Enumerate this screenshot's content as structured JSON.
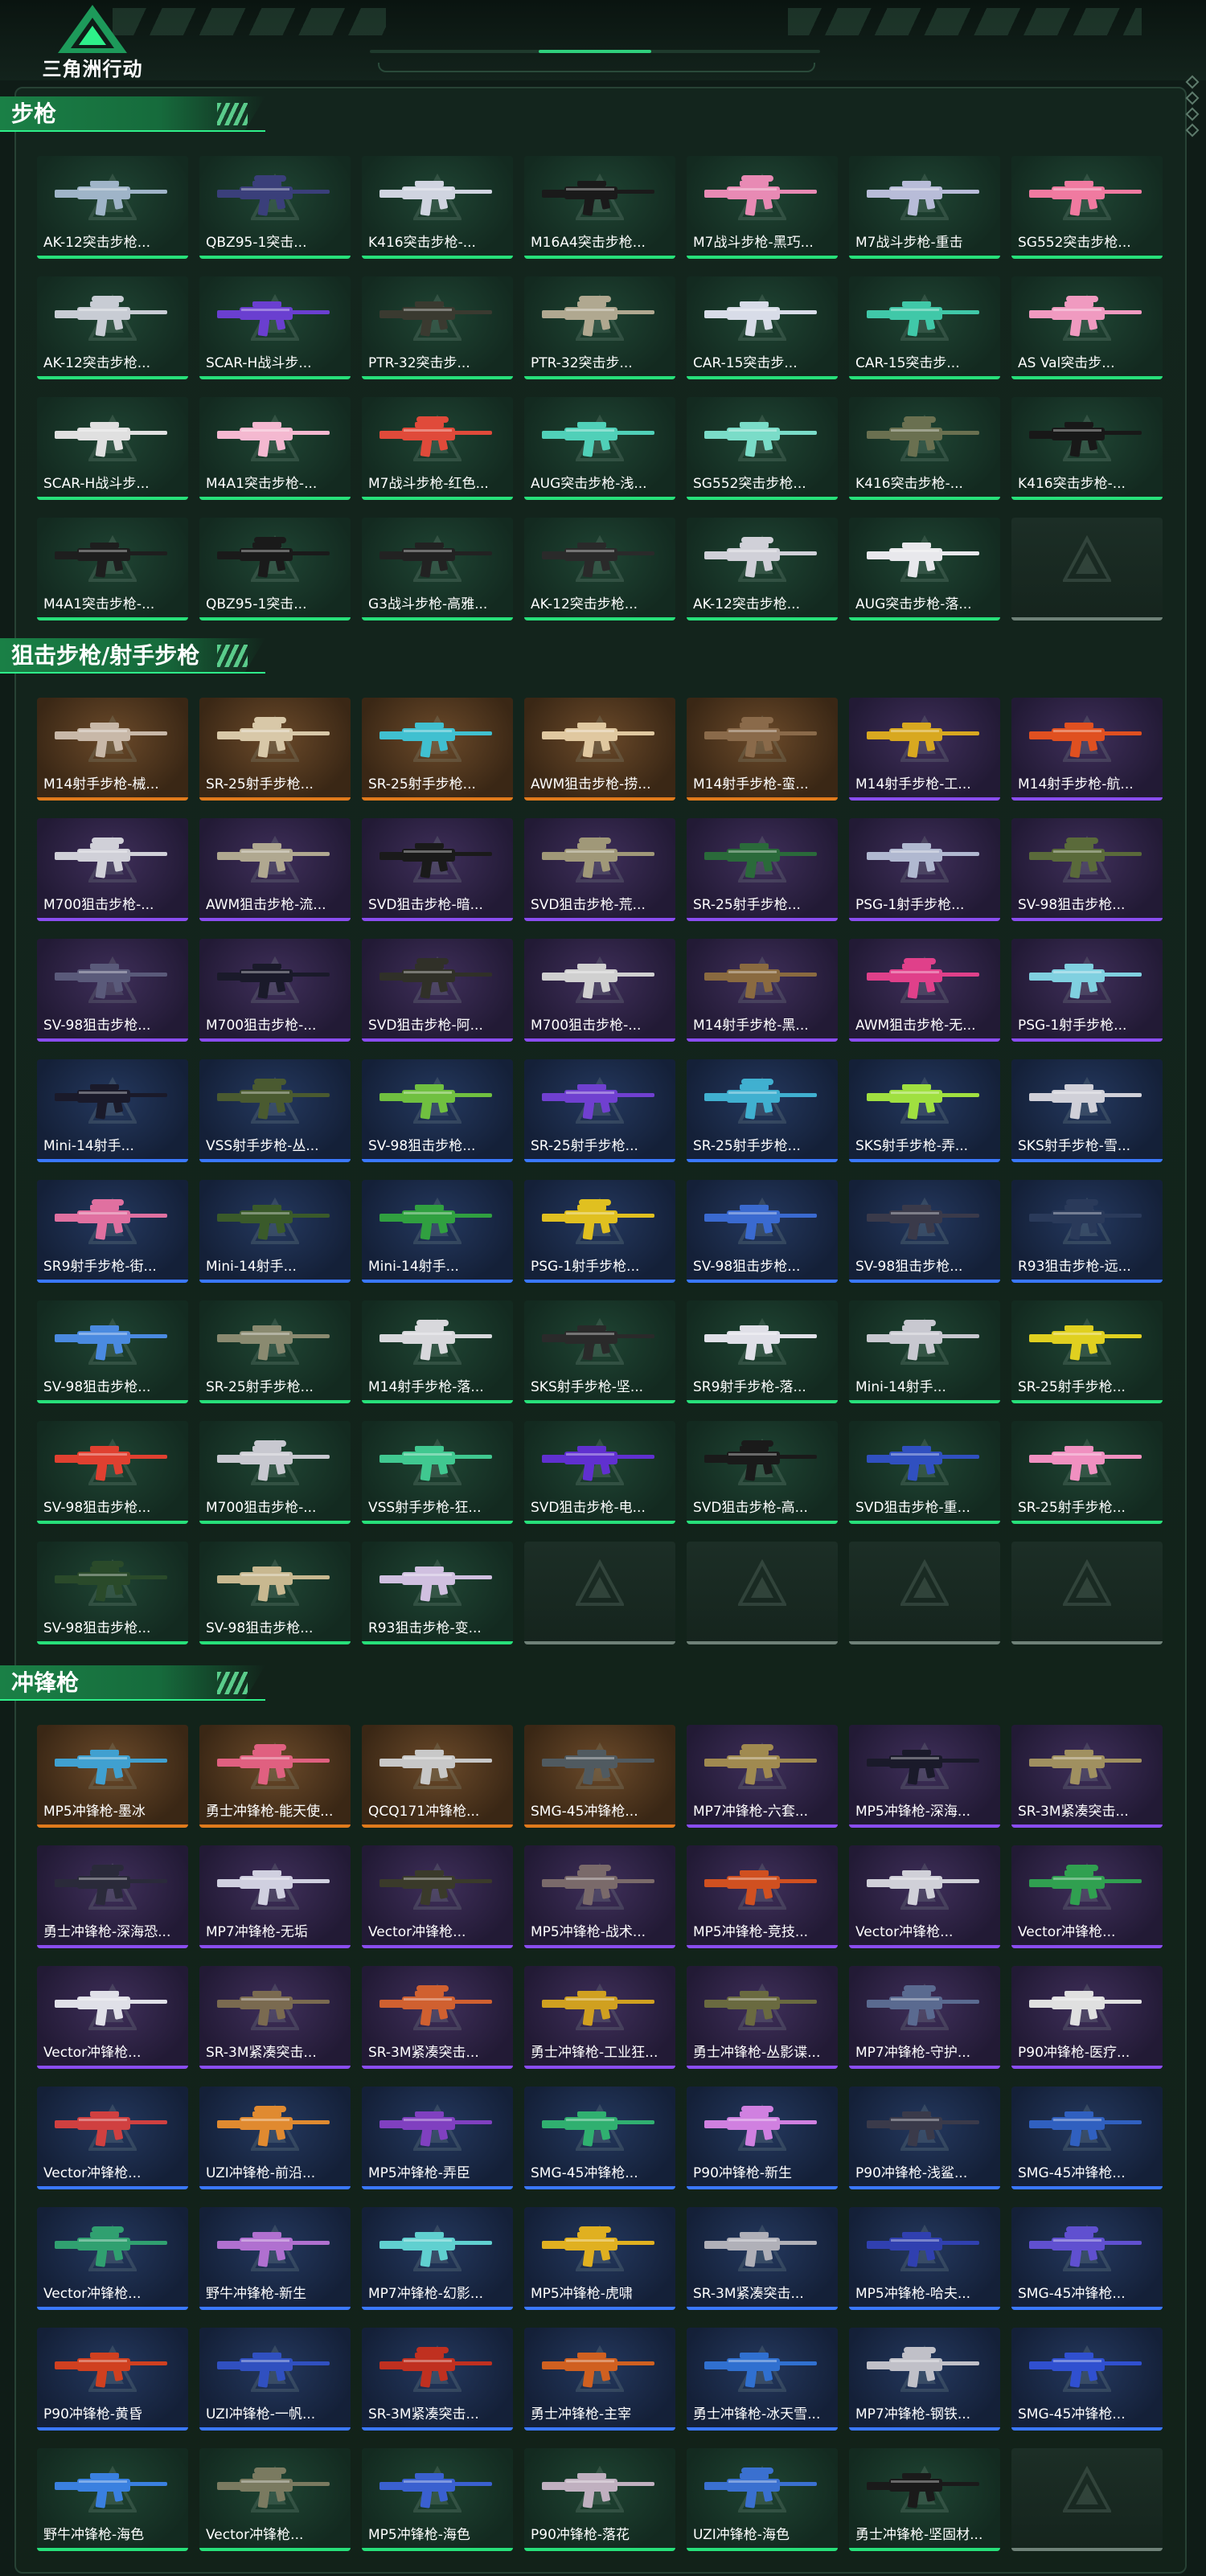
{
  "brand": {
    "logo_text": "三角洲行动",
    "logo_icon": "delta-triangle-icon",
    "accent": "#2ef08a"
  },
  "sections": [
    {
      "title": "步枪",
      "items": [
        {
          "name": "AK-12突击步枪...",
          "color": "#9fb4c8",
          "tier": "green"
        },
        {
          "name": "QBZ95-1突击...",
          "color": "#3a3f7a",
          "tier": "green"
        },
        {
          "name": "K416突击步枪-...",
          "color": "#d0d4e0",
          "tier": "green"
        },
        {
          "name": "M16A4突击步枪...",
          "color": "#1a1a1a",
          "tier": "green"
        },
        {
          "name": "M7战斗步枪-黑巧...",
          "color": "#e88ab4",
          "tier": "green"
        },
        {
          "name": "M7战斗步枪-重击",
          "color": "#b8bcd8",
          "tier": "green"
        },
        {
          "name": "SG552突击步枪...",
          "color": "#f07aa0",
          "tier": "green"
        },
        {
          "name": "AK-12突击步枪...",
          "color": "#c8ccd4",
          "tier": "green"
        },
        {
          "name": "SCAR-H战斗步...",
          "color": "#6a3fd0",
          "tier": "green"
        },
        {
          "name": "PTR-32突击步...",
          "color": "#3a3a30",
          "tier": "green"
        },
        {
          "name": "PTR-32突击步...",
          "color": "#b0a890",
          "tier": "green"
        },
        {
          "name": "CAR-15突击步...",
          "color": "#d8dce8",
          "tier": "green"
        },
        {
          "name": "CAR-15突击步...",
          "color": "#40c8a8",
          "tier": "green"
        },
        {
          "name": "AS Val突击步...",
          "color": "#f09ac0",
          "tier": "green"
        },
        {
          "name": "SCAR-H战斗步...",
          "color": "#e0e0e0",
          "tier": "green"
        },
        {
          "name": "M4A1突击步枪-...",
          "color": "#f4b8d0",
          "tier": "green"
        },
        {
          "name": "M7战斗步枪-红色...",
          "color": "#e04a3a",
          "tier": "green"
        },
        {
          "name": "AUG突击步枪-浅...",
          "color": "#50d0b8",
          "tier": "green"
        },
        {
          "name": "SG552突击步枪...",
          "color": "#7adcc8",
          "tier": "green"
        },
        {
          "name": "K416突击步枪-...",
          "color": "#6a7050",
          "tier": "green"
        },
        {
          "name": "K416突击步枪-...",
          "color": "#181818",
          "tier": "green"
        },
        {
          "name": "M4A1突击步枪-...",
          "color": "#1e1e1e",
          "tier": "green"
        },
        {
          "name": "QBZ95-1突击...",
          "color": "#1a1a1a",
          "tier": "green"
        },
        {
          "name": "G3战斗步枪-高雅...",
          "color": "#222222",
          "tier": "green"
        },
        {
          "name": "AK-12突击步枪...",
          "color": "#2a2a2a",
          "tier": "green"
        },
        {
          "name": "AK-12突击步枪...",
          "color": "#d0d0d8",
          "tier": "green"
        },
        {
          "name": "AUG突击步枪-落...",
          "color": "#e8e8ec",
          "tier": "green"
        },
        {
          "name": "",
          "color": "",
          "tier": "empty"
        }
      ]
    },
    {
      "title": "狙击步枪/射手步枪",
      "items": [
        {
          "name": "M14射手步枪-械...",
          "color": "#c8b8a8",
          "tier": "gold"
        },
        {
          "name": "SR-25射手步枪...",
          "color": "#d8c8a8",
          "tier": "gold"
        },
        {
          "name": "SR-25射手步枪...",
          "color": "#40c0d0",
          "tier": "gold"
        },
        {
          "name": "AWM狙击步枪-捞...",
          "color": "#e0c8a0",
          "tier": "gold"
        },
        {
          "name": "M14射手步枪-蛮...",
          "color": "#8a6a4a",
          "tier": "gold"
        },
        {
          "name": "M14射手步枪-工...",
          "color": "#d8a820",
          "tier": "purple"
        },
        {
          "name": "M14射手步枪-航...",
          "color": "#e05020",
          "tier": "purple"
        },
        {
          "name": "M700狙击步枪-...",
          "color": "#d0d0d8",
          "tier": "purple"
        },
        {
          "name": "AWM狙击步枪-流...",
          "color": "#b0a890",
          "tier": "purple"
        },
        {
          "name": "SVD狙击步枪-暗...",
          "color": "#1a1a1a",
          "tier": "purple"
        },
        {
          "name": "SVD狙击步枪-荒...",
          "color": "#a09878",
          "tier": "purple"
        },
        {
          "name": "SR-25射手步枪...",
          "color": "#2a6a3a",
          "tier": "purple"
        },
        {
          "name": "PSG-1射手步枪...",
          "color": "#b0b8d0",
          "tier": "purple"
        },
        {
          "name": "SV-98狙击步枪...",
          "color": "#5a6a3a",
          "tier": "purple"
        },
        {
          "name": "SV-98狙击步枪...",
          "color": "#5a5a7a",
          "tier": "purple"
        },
        {
          "name": "M700狙击步枪-...",
          "color": "#1a1a2a",
          "tier": "purple"
        },
        {
          "name": "SVD狙击步枪-阿...",
          "color": "#303028",
          "tier": "purple"
        },
        {
          "name": "M700狙击步枪-...",
          "color": "#d0d0d0",
          "tier": "purple"
        },
        {
          "name": "M14射手步枪-黑...",
          "color": "#8a6a40",
          "tier": "purple"
        },
        {
          "name": "AWM狙击步枪-无...",
          "color": "#e0408a",
          "tier": "purple"
        },
        {
          "name": "PSG-1射手步枪...",
          "color": "#80d0e0",
          "tier": "purple"
        },
        {
          "name": "Mini-14射手...",
          "color": "#1a1a2a",
          "tier": "blue"
        },
        {
          "name": "VSS射手步枪-丛...",
          "color": "#4a5a30",
          "tier": "blue"
        },
        {
          "name": "SV-98狙击步枪...",
          "color": "#70c040",
          "tier": "blue"
        },
        {
          "name": "SR-25射手步枪...",
          "color": "#7040d0",
          "tier": "blue"
        },
        {
          "name": "SR-25射手步枪...",
          "color": "#40b0d0",
          "tier": "blue"
        },
        {
          "name": "SKS射手步枪-弄...",
          "color": "#a0e040",
          "tier": "blue"
        },
        {
          "name": "SKS射手步枪-雪...",
          "color": "#d0d0d8",
          "tier": "blue"
        },
        {
          "name": "SR9射手步枪-街...",
          "color": "#e070a0",
          "tier": "blue"
        },
        {
          "name": "Mini-14射手...",
          "color": "#3a5a2a",
          "tier": "blue"
        },
        {
          "name": "Mini-14射手...",
          "color": "#30a040",
          "tier": "blue"
        },
        {
          "name": "PSG-1射手步枪...",
          "color": "#e0c020",
          "tier": "blue"
        },
        {
          "name": "SV-98狙击步枪...",
          "color": "#3a6ad0",
          "tier": "blue"
        },
        {
          "name": "SV-98狙击步枪...",
          "color": "#3a3a4a",
          "tier": "blue"
        },
        {
          "name": "R93狙击步枪-远...",
          "color": "#2a3a5a",
          "tier": "blue"
        },
        {
          "name": "SV-98狙击步枪...",
          "color": "#4a8ae0",
          "tier": "green"
        },
        {
          "name": "SR-25射手步枪...",
          "color": "#8a8a70",
          "tier": "green"
        },
        {
          "name": "M14射手步枪-落...",
          "color": "#d8d8dc",
          "tier": "green"
        },
        {
          "name": "SKS射手步枪-坚...",
          "color": "#2a2a2a",
          "tier": "green"
        },
        {
          "name": "SR9射手步枪-落...",
          "color": "#e0e0e8",
          "tier": "green"
        },
        {
          "name": "Mini-14射手...",
          "color": "#c8c8d0",
          "tier": "green"
        },
        {
          "name": "SR-25射手步枪...",
          "color": "#e0d020",
          "tier": "green"
        },
        {
          "name": "SV-98狙击步枪...",
          "color": "#e04030",
          "tier": "green"
        },
        {
          "name": "M700狙击步枪-...",
          "color": "#c8c8d0",
          "tier": "green"
        },
        {
          "name": "VSS射手步枪-狂...",
          "color": "#40c890",
          "tier": "green"
        },
        {
          "name": "SVD狙击步枪-电...",
          "color": "#6030d0",
          "tier": "green"
        },
        {
          "name": "SVD狙击步枪-高...",
          "color": "#1a1a1a",
          "tier": "green"
        },
        {
          "name": "SVD狙击步枪-重...",
          "color": "#3050c0",
          "tier": "green"
        },
        {
          "name": "SR-25射手步枪...",
          "color": "#f090c0",
          "tier": "green"
        },
        {
          "name": "SV-98狙击步枪...",
          "color": "#2a4a2a",
          "tier": "green"
        },
        {
          "name": "SV-98狙击步枪...",
          "color": "#c8b890",
          "tier": "green"
        },
        {
          "name": "R93狙击步枪-变...",
          "color": "#d0c0e0",
          "tier": "green"
        },
        {
          "name": "",
          "color": "",
          "tier": "empty"
        },
        {
          "name": "",
          "color": "",
          "tier": "empty"
        },
        {
          "name": "",
          "color": "",
          "tier": "empty"
        },
        {
          "name": "",
          "color": "",
          "tier": "empty"
        }
      ]
    },
    {
      "title": "冲锋枪",
      "items": [
        {
          "name": "MP5冲锋枪-墨冰",
          "color": "#40a0d0",
          "tier": "gold"
        },
        {
          "name": "勇士冲锋枪-能天使...",
          "color": "#e06080",
          "tier": "gold"
        },
        {
          "name": "QCQ171冲锋枪...",
          "color": "#c8c8c8",
          "tier": "gold"
        },
        {
          "name": "SMG-45冲锋枪...",
          "color": "#505a60",
          "tier": "gold"
        },
        {
          "name": "MP7冲锋枪-六套...",
          "color": "#a08a50",
          "tier": "purple"
        },
        {
          "name": "MP5冲锋枪-深海...",
          "color": "#1a1a2a",
          "tier": "purple"
        },
        {
          "name": "SR-3M紧凑突击...",
          "color": "#a09060",
          "tier": "purple"
        },
        {
          "name": "勇士冲锋枪-深海恐...",
          "color": "#2a2a3a",
          "tier": "purple"
        },
        {
          "name": "MP7冲锋枪-无垢",
          "color": "#d0d0e0",
          "tier": "purple"
        },
        {
          "name": "Vector冲锋枪...",
          "color": "#3a3a2a",
          "tier": "purple"
        },
        {
          "name": "MP5冲锋枪-战术...",
          "color": "#7a6a6a",
          "tier": "purple"
        },
        {
          "name": "MP5冲锋枪-竞技...",
          "color": "#d05020",
          "tier": "purple"
        },
        {
          "name": "Vector冲锋枪...",
          "color": "#d0d0d8",
          "tier": "purple"
        },
        {
          "name": "Vector冲锋枪...",
          "color": "#30a050",
          "tier": "purple"
        },
        {
          "name": "Vector冲锋枪...",
          "color": "#e0e0e8",
          "tier": "purple"
        },
        {
          "name": "SR-3M紧凑突击...",
          "color": "#7a6a50",
          "tier": "purple"
        },
        {
          "name": "SR-3M紧凑突击...",
          "color": "#d06030",
          "tier": "purple"
        },
        {
          "name": "勇士冲锋枪-工业狂...",
          "color": "#d0a020",
          "tier": "purple"
        },
        {
          "name": "勇士冲锋枪-丛影谍...",
          "color": "#6a6a40",
          "tier": "purple"
        },
        {
          "name": "MP7冲锋枪-守护...",
          "color": "#5a6a90",
          "tier": "purple"
        },
        {
          "name": "P90冲锋枪-医疗...",
          "color": "#e0e0e0",
          "tier": "purple"
        },
        {
          "name": "Vector冲锋枪...",
          "color": "#d04040",
          "tier": "blue"
        },
        {
          "name": "UZI冲锋枪-前沿...",
          "color": "#e08a30",
          "tier": "blue"
        },
        {
          "name": "MP5冲锋枪-弄臣",
          "color": "#8040c0",
          "tier": "blue"
        },
        {
          "name": "SMG-45冲锋枪...",
          "color": "#30b070",
          "tier": "blue"
        },
        {
          "name": "P90冲锋枪-新生",
          "color": "#d080e0",
          "tier": "blue"
        },
        {
          "name": "P90冲锋枪-浅鲨...",
          "color": "#3a3a4a",
          "tier": "blue"
        },
        {
          "name": "SMG-45冲锋枪...",
          "color": "#3060c0",
          "tier": "blue"
        },
        {
          "name": "Vector冲锋枪...",
          "color": "#30a070",
          "tier": "blue"
        },
        {
          "name": "野牛冲锋枪-新生",
          "color": "#b070d0",
          "tier": "blue"
        },
        {
          "name": "MP7冲锋枪-幻影...",
          "color": "#60d0d0",
          "tier": "blue"
        },
        {
          "name": "MP5冲锋枪-虎啸",
          "color": "#e0b020",
          "tier": "blue"
        },
        {
          "name": "SR-3M紧凑突击...",
          "color": "#b0b0b8",
          "tier": "blue"
        },
        {
          "name": "MP5冲锋枪-哈夫...",
          "color": "#3040b0",
          "tier": "blue"
        },
        {
          "name": "SMG-45冲锋枪...",
          "color": "#6050d0",
          "tier": "blue"
        },
        {
          "name": "P90冲锋枪-黄昏",
          "color": "#d04020",
          "tier": "blue"
        },
        {
          "name": "UZI冲锋枪-一帆...",
          "color": "#3050c0",
          "tier": "blue"
        },
        {
          "name": "SR-3M紧凑突击...",
          "color": "#c03020",
          "tier": "blue"
        },
        {
          "name": "勇士冲锋枪-主宰",
          "color": "#d06020",
          "tier": "blue"
        },
        {
          "name": "勇士冲锋枪-冰天雪...",
          "color": "#3070d0",
          "tier": "blue"
        },
        {
          "name": "MP7冲锋枪-钢铁...",
          "color": "#c0c0c8",
          "tier": "blue"
        },
        {
          "name": "SMG-45冲锋枪...",
          "color": "#3050d0",
          "tier": "blue"
        },
        {
          "name": "野牛冲锋枪-海色",
          "color": "#3a80e0",
          "tier": "green"
        },
        {
          "name": "Vector冲锋枪...",
          "color": "#7a7a60",
          "tier": "green"
        },
        {
          "name": "MP5冲锋枪-海色",
          "color": "#3a60d0",
          "tier": "green"
        },
        {
          "name": "P90冲锋枪-落花",
          "color": "#c0b0c0",
          "tier": "green"
        },
        {
          "name": "UZI冲锋枪-海色",
          "color": "#3a70d0",
          "tier": "green"
        },
        {
          "name": "勇士冲锋枪-坚固材...",
          "color": "#1a1a1a",
          "tier": "green"
        },
        {
          "name": "",
          "color": "",
          "tier": "empty"
        }
      ]
    }
  ]
}
